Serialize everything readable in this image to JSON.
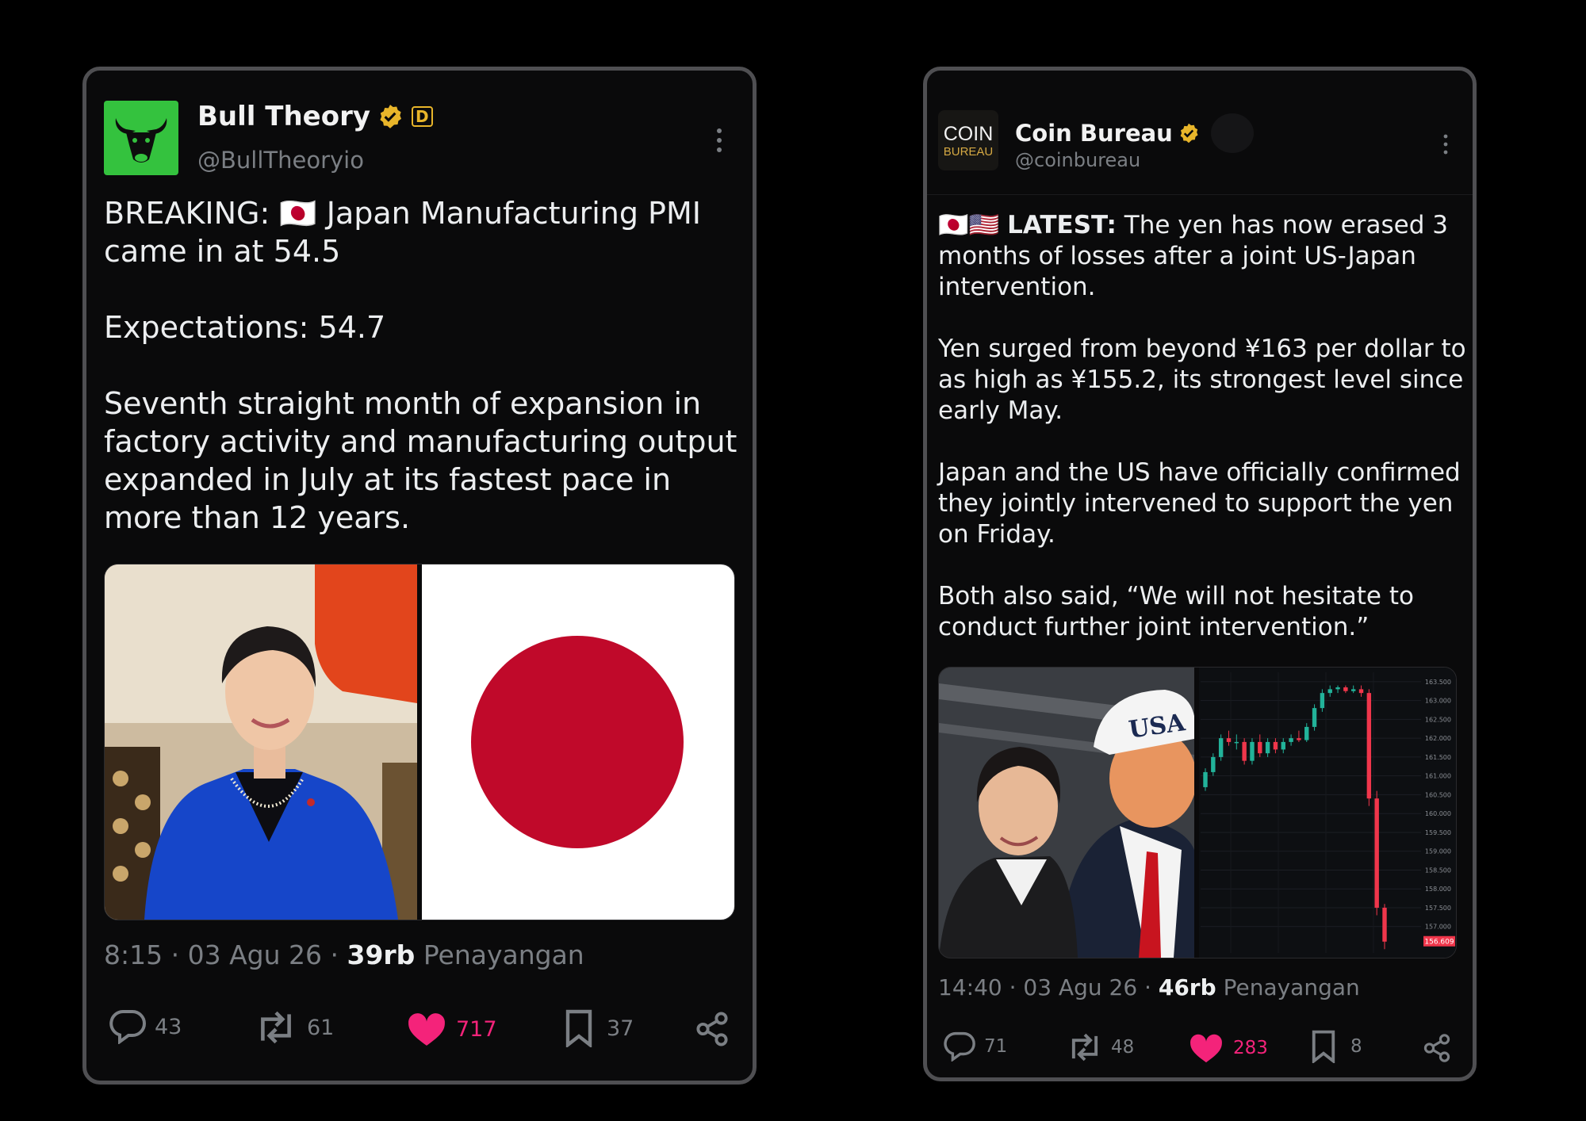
{
  "posts": [
    {
      "author": {
        "name": "Bull Theory",
        "handle": "@BullTheoryio",
        "affiliate_mark": "D"
      },
      "body": [
        "BREAKING: 🇯🇵 Japan Manufacturing PMI came in at 54.5",
        "Expectations: 54.7",
        "Seventh straight month of expansion in factory activity and manufacturing output expanded in July at its fastest pace in more than 12 years."
      ],
      "media": [
        "portrait photo",
        "Japanese flag"
      ],
      "meta": {
        "time": "8:15",
        "date": "03 Agu 26",
        "views": "39rb",
        "views_label": "Penayangan"
      },
      "actions": {
        "replies": "43",
        "reposts": "61",
        "likes": "717",
        "bookmarks": "37"
      },
      "liked": true
    },
    {
      "author": {
        "name": "Coin Bureau",
        "handle": "@coinbureau",
        "avatar_line1": "COIN",
        "avatar_line2": "BUREAU"
      },
      "body": {
        "lead_flags": "🇯🇵🇺🇸",
        "lead_label": "LATEST:",
        "lead_text": "The yen has now erased 3 months of losses after a joint US-Japan intervention.",
        "paragraphs": [
          "Yen surged from beyond ¥163 per dollar to as high as ¥155.2, its strongest level since early May.",
          "Japan and the US have officially confirmed they jointly intervened to support the yen on Friday.",
          "Both also said, “We will not hesitate to conduct further joint intervention.”"
        ]
      },
      "media": {
        "photo": "photo of two people",
        "cap_text": "USA",
        "chart_price_tag": "156.609"
      },
      "meta": {
        "time": "14:40",
        "date": "03 Agu 26",
        "views": "46rb",
        "views_label": "Penayangan"
      },
      "actions": {
        "replies": "71",
        "reposts": "48",
        "likes": "283",
        "bookmarks": "8"
      },
      "liked": true
    }
  ],
  "chart_data": {
    "type": "candlestick",
    "y_ticks": [
      "163.500",
      "163.000",
      "162.500",
      "162.000",
      "161.500",
      "161.000",
      "160.500",
      "160.000",
      "159.500",
      "159.000",
      "158.500",
      "158.000",
      "157.500",
      "157.000"
    ],
    "ylim": [
      156.3,
      163.75
    ],
    "price_tag": "156.609",
    "candles": [
      {
        "o": 160.7,
        "h": 161.2,
        "l": 160.6,
        "c": 161.1
      },
      {
        "o": 161.1,
        "h": 161.6,
        "l": 161.0,
        "c": 161.5
      },
      {
        "o": 161.5,
        "h": 162.1,
        "l": 161.4,
        "c": 162.0
      },
      {
        "o": 162.0,
        "h": 162.2,
        "l": 161.8,
        "c": 161.9
      },
      {
        "o": 161.9,
        "h": 162.1,
        "l": 161.7,
        "c": 161.9
      },
      {
        "o": 161.9,
        "h": 162.0,
        "l": 161.3,
        "c": 161.4
      },
      {
        "o": 161.4,
        "h": 162.0,
        "l": 161.3,
        "c": 161.9
      },
      {
        "o": 161.9,
        "h": 162.1,
        "l": 161.5,
        "c": 161.6
      },
      {
        "o": 161.6,
        "h": 162.0,
        "l": 161.5,
        "c": 161.9
      },
      {
        "o": 161.9,
        "h": 162.0,
        "l": 161.6,
        "c": 161.7
      },
      {
        "o": 161.7,
        "h": 162.0,
        "l": 161.6,
        "c": 161.9
      },
      {
        "o": 161.9,
        "h": 162.1,
        "l": 161.8,
        "c": 162.0
      },
      {
        "o": 162.0,
        "h": 162.2,
        "l": 161.9,
        "c": 161.95
      },
      {
        "o": 161.95,
        "h": 162.4,
        "l": 161.9,
        "c": 162.3
      },
      {
        "o": 162.3,
        "h": 162.9,
        "l": 162.2,
        "c": 162.8
      },
      {
        "o": 162.8,
        "h": 163.3,
        "l": 162.7,
        "c": 163.2
      },
      {
        "o": 163.2,
        "h": 163.4,
        "l": 163.1,
        "c": 163.3
      },
      {
        "o": 163.3,
        "h": 163.4,
        "l": 163.2,
        "c": 163.35
      },
      {
        "o": 163.35,
        "h": 163.4,
        "l": 163.2,
        "c": 163.25
      },
      {
        "o": 163.25,
        "h": 163.4,
        "l": 163.2,
        "c": 163.3
      },
      {
        "o": 163.3,
        "h": 163.4,
        "l": 163.1,
        "c": 163.2
      },
      {
        "o": 163.2,
        "h": 163.3,
        "l": 160.2,
        "c": 160.4
      },
      {
        "o": 160.4,
        "h": 160.6,
        "l": 157.3,
        "c": 157.5
      },
      {
        "o": 157.5,
        "h": 157.6,
        "l": 156.4,
        "c": 156.6
      }
    ]
  },
  "colors": {
    "background": "#000000",
    "card": "#0a0a0b",
    "card_border": "#4f4f52",
    "like": "#f4237a",
    "verified": "#e8b52a",
    "candle_up": "#22b39a",
    "candle_down": "#f0364b",
    "avatar_green": "#34c23e"
  }
}
